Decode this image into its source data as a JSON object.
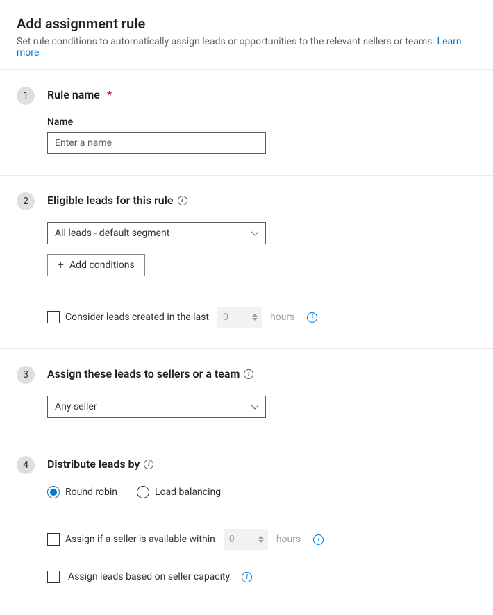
{
  "header": {
    "title": "Add assignment rule",
    "subtitle": "Set rule conditions to automatically assign leads or opportunities to the relevant sellers or teams. ",
    "learn_more": "Learn more"
  },
  "step1": {
    "num": "1",
    "heading": "Rule name",
    "field_label": "Name",
    "placeholder": "Enter a name"
  },
  "step2": {
    "num": "2",
    "heading": "Eligible leads for this rule",
    "dropdown_value": "All leads - default segment",
    "add_conditions": "Add conditions",
    "consider_label": "Consider leads created in the last",
    "spinner_value": "0",
    "spinner_unit": "hours"
  },
  "step3": {
    "num": "3",
    "heading": "Assign these leads to sellers or a team",
    "dropdown_value": "Any seller"
  },
  "step4": {
    "num": "4",
    "heading": "Distribute leads by",
    "radio1": "Round robin",
    "radio2": "Load balancing",
    "assign_within_label": "Assign if a seller is available within",
    "spinner_value": "0",
    "spinner_unit": "hours",
    "capacity_label": "Assign leads based on seller capacity."
  }
}
